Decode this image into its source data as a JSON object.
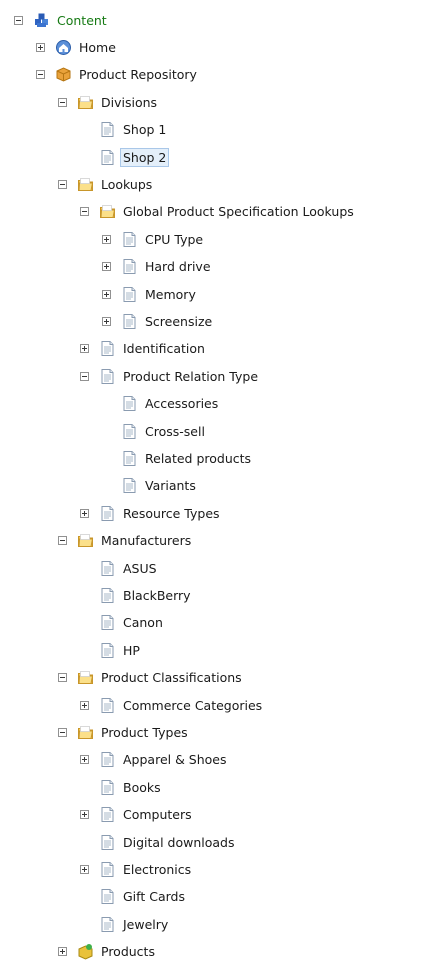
{
  "tree": {
    "nodes": [
      {
        "label": "Content",
        "level": 0,
        "icon": "content-stack-icon",
        "toggle": "minus"
      },
      {
        "label": "Home",
        "level": 1,
        "icon": "home-icon",
        "toggle": "plus"
      },
      {
        "label": "Product Repository",
        "level": 1,
        "icon": "repository-icon",
        "toggle": "minus"
      },
      {
        "label": "Divisions",
        "level": 2,
        "icon": "folder-icon",
        "toggle": "minus"
      },
      {
        "label": "Shop 1",
        "level": 3,
        "icon": "document-icon",
        "toggle": "none"
      },
      {
        "label": "Shop 2",
        "level": 3,
        "icon": "document-icon",
        "toggle": "none",
        "selected": true
      },
      {
        "label": "Lookups",
        "level": 2,
        "icon": "folder-icon",
        "toggle": "minus"
      },
      {
        "label": "Global Product Specification Lookups",
        "level": 3,
        "icon": "folder-icon",
        "toggle": "minus"
      },
      {
        "label": "CPU Type",
        "level": 4,
        "icon": "document-icon",
        "toggle": "plus"
      },
      {
        "label": "Hard drive",
        "level": 4,
        "icon": "document-icon",
        "toggle": "plus"
      },
      {
        "label": "Memory",
        "level": 4,
        "icon": "document-icon",
        "toggle": "plus"
      },
      {
        "label": "Screensize",
        "level": 4,
        "icon": "document-icon",
        "toggle": "plus"
      },
      {
        "label": "Identification",
        "level": 3,
        "icon": "document-icon",
        "toggle": "plus"
      },
      {
        "label": "Product Relation Type",
        "level": 3,
        "icon": "document-icon",
        "toggle": "minus"
      },
      {
        "label": "Accessories",
        "level": 4,
        "icon": "document-icon",
        "toggle": "none"
      },
      {
        "label": "Cross-sell",
        "level": 4,
        "icon": "document-icon",
        "toggle": "none"
      },
      {
        "label": "Related products",
        "level": 4,
        "icon": "document-icon",
        "toggle": "none"
      },
      {
        "label": "Variants",
        "level": 4,
        "icon": "document-icon",
        "toggle": "none"
      },
      {
        "label": "Resource Types",
        "level": 3,
        "icon": "document-icon",
        "toggle": "plus"
      },
      {
        "label": "Manufacturers",
        "level": 2,
        "icon": "folder-icon",
        "toggle": "minus"
      },
      {
        "label": "ASUS",
        "level": 3,
        "icon": "document-icon",
        "toggle": "none"
      },
      {
        "label": "BlackBerry",
        "level": 3,
        "icon": "document-icon",
        "toggle": "none"
      },
      {
        "label": "Canon",
        "level": 3,
        "icon": "document-icon",
        "toggle": "none"
      },
      {
        "label": "HP",
        "level": 3,
        "icon": "document-icon",
        "toggle": "none"
      },
      {
        "label": "Product Classifications",
        "level": 2,
        "icon": "folder-icon",
        "toggle": "minus"
      },
      {
        "label": "Commerce Categories",
        "level": 3,
        "icon": "document-icon",
        "toggle": "plus"
      },
      {
        "label": "Product Types",
        "level": 2,
        "icon": "folder-icon",
        "toggle": "minus"
      },
      {
        "label": "Apparel & Shoes",
        "level": 3,
        "icon": "document-icon",
        "toggle": "plus"
      },
      {
        "label": "Books",
        "level": 3,
        "icon": "document-icon",
        "toggle": "none"
      },
      {
        "label": "Computers",
        "level": 3,
        "icon": "document-icon",
        "toggle": "plus"
      },
      {
        "label": "Digital downloads",
        "level": 3,
        "icon": "document-icon",
        "toggle": "none"
      },
      {
        "label": "Electronics",
        "level": 3,
        "icon": "document-icon",
        "toggle": "plus"
      },
      {
        "label": "Gift Cards",
        "level": 3,
        "icon": "document-icon",
        "toggle": "none"
      },
      {
        "label": "Jewelry",
        "level": 3,
        "icon": "document-icon",
        "toggle": "none"
      },
      {
        "label": "Products",
        "level": 2,
        "icon": "products-icon",
        "toggle": "plus"
      }
    ]
  }
}
